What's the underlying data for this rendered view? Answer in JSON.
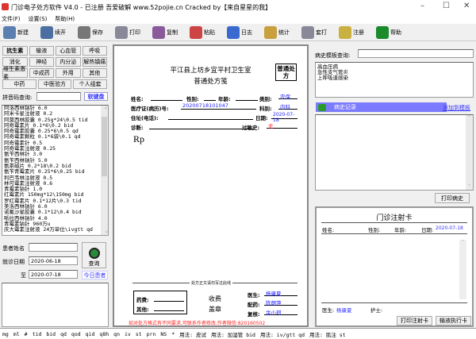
{
  "window": {
    "title": "门诊电子处方软件 V4.0 - 已注册 吾爱破解 www.52pojie.cn Cracked by【来自星星的我】",
    "min": "–",
    "max": "☐",
    "close": "✕"
  },
  "menu": [
    "文件(F)",
    "设置(S)",
    "帮助(H)"
  ],
  "toolbar": [
    {
      "label": "新建",
      "icon": "new-icon",
      "color": "#5a7fb0"
    },
    {
      "label": "续开",
      "icon": "continue-icon",
      "color": "#4a6fa0"
    },
    {
      "label": "保存",
      "icon": "save-icon",
      "color": "#777"
    },
    {
      "label": "打印",
      "icon": "print-icon",
      "color": "#889"
    },
    {
      "label": "复制",
      "icon": "copy-icon",
      "color": "#8a5a9a"
    },
    {
      "label": "粘贴",
      "icon": "paste-icon",
      "color": "#c44"
    },
    {
      "label": "日志",
      "icon": "log-icon",
      "color": "#3a6ad0"
    },
    {
      "label": "统计",
      "icon": "stats-icon",
      "color": "#c9a040"
    },
    {
      "label": "套打",
      "icon": "template-print-icon",
      "color": "#889"
    },
    {
      "label": "注册",
      "icon": "key-icon",
      "color": "#c9b040"
    },
    {
      "label": "帮助",
      "icon": "help-icon",
      "color": "#1a8a2a"
    }
  ],
  "left": {
    "categories": [
      [
        "抗生素",
        "输液",
        "心血管",
        "呼吸"
      ],
      [
        "消化",
        "神经",
        "内分泌",
        "解热镇痛"
      ],
      [
        "维生素激素",
        "中成药",
        "外用",
        "其他"
      ],
      [
        "中药",
        "中医验方",
        "个人组套"
      ]
    ],
    "pinyin_label": "拼音码查询:",
    "soft_keyboard": "软键盘",
    "drugs": [
      "阿洛西林钠针 6.0",
      "阿米卡星注射液  0.2",
      "阿莫西林胶囊  0.25g*24\\0.5  tid",
      "阿奇霉素片  0.1*6\\0.2 bid",
      "阿奇霉素胶囊  0.25*6\\0.5   qd",
      "阿奇霉素颗粒  0.1*6袋\\0.1  qd",
      "阿奇霉素针  0.5",
      "阿奇霉素注射液  0.25",
      "氨苄西林针  3.0",
      "氨苄西林钠针 5.0",
      "氨茶碱片  0.2*18\\0.2 bid",
      "氨苄青霉素片  0.25*6\\0.25 bid",
      "利巴韦林注射液  0.5",
      "林可霉素注射液  0.6",
      "青霉素钠针  1.0",
      "红霉素片 150mg*12\\150mg bid",
      "罗红霉素片  0.1*12片\\0.3 tid",
      "美洛西林钠针 6.0",
      "诺氟沙星胶囊  0.1*12\\0.4   bid",
      "哌拉西林钠针 4.0",
      "青霉素钠针  960万u",
      "庆大霉素注射液  24万单位\\ivgtt qd"
    ],
    "patient_name_label": "患者姓名",
    "patient_name": "",
    "visit_date_label": "就诊日期",
    "date_from": "2020-06-18",
    "to_label": "至",
    "date_to": "2020-07-18",
    "query_label": "查询",
    "today_label": "今日患者"
  },
  "rx": {
    "clinic": "平江县上坊乡宜平村卫生室",
    "title": "普通处方笺",
    "badge": "普通处方",
    "name_label": "姓名:",
    "sex_label": "性别:",
    "age_label": "年龄:",
    "category_label": "类别:",
    "category": "农保",
    "record_label": "医疗证(病历)号:",
    "record_no": "20200718101047",
    "dept_label": "科别:",
    "dept": "内科",
    "address_label": "住址(电话):",
    "date_label": "日期:",
    "date": "2020-07-18",
    "diagnosis_label": "诊断:",
    "allergy_label": "过敏史:",
    "allergy": "无",
    "rp": "Rp",
    "divider_note": "处方正文请勿写过此线",
    "drug_fee_label": "药费:",
    "other_fee_label": "其他:",
    "stamp_line1": "收费",
    "stamp_line2": "盖章",
    "doctor_label": "医生:",
    "doctor": "杨康夏",
    "dispense_label": "配药:",
    "dispenser": "陈朗萍",
    "check_label": "复核:",
    "checker": "余小珂",
    "notice": "如对处方格式有不同要求,可联系作者修改,作者微信:820160502"
  },
  "right": {
    "template_query_label": "病史模板查询:",
    "templates": [
      "高血压病",
      "急性支气管炎",
      "上呼吸道感染"
    ],
    "history_header": "病史记录",
    "add_template": "添加到模板",
    "print_history": "打印病史",
    "card_title": "门诊注射卡",
    "name_label": "姓名:",
    "sex_label": "性别:",
    "age_label": "年龄:",
    "date_label": "日期:",
    "date": "2020-07-18",
    "doctor_label": "医生:",
    "doctor": "杨康夏",
    "nurse_label": "护士:",
    "print_card": "打印注射卡",
    "exec_card": "输液执行卡"
  },
  "bottom": [
    "mg",
    "ml",
    "#",
    "tid",
    "bid",
    "qd",
    "qod",
    "qid",
    "q8h",
    "qn",
    "iv",
    "st",
    "prn",
    "NS",
    "*",
    "用法: 皮试",
    "用法: 加湿管 bid",
    "用法: iv/gtt qd",
    "用法: 肌注 st"
  ],
  "colors": {
    "accent": "#7b7bff",
    "link": "#3333ff",
    "red": "#ff2020"
  }
}
